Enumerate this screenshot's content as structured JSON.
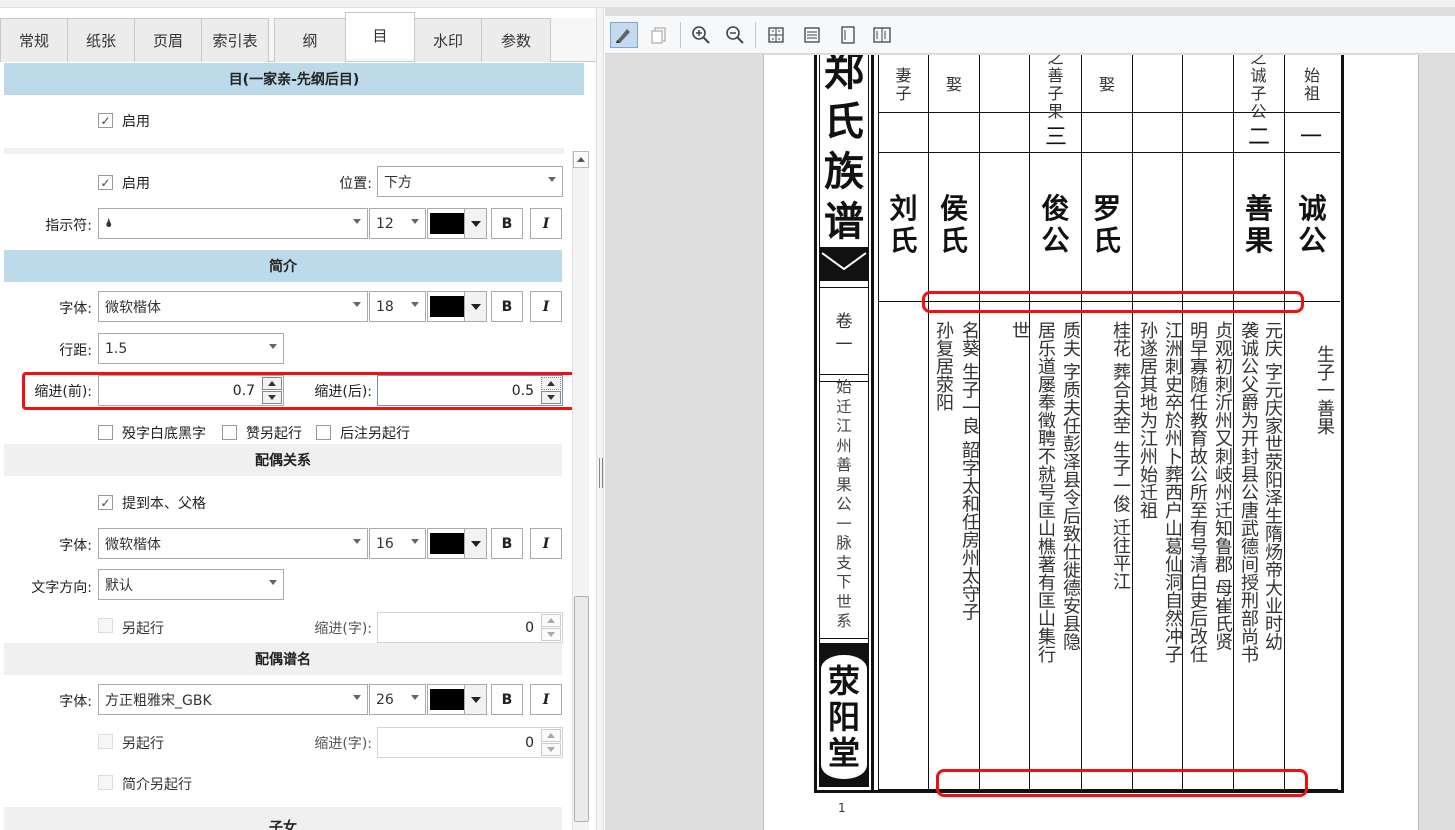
{
  "tabs": [
    "常规",
    "纸张",
    "页眉",
    "索引表",
    "纲",
    "目",
    "水印",
    "参数"
  ],
  "active_tab": "目",
  "sections": {
    "mu_title": "目(一家亲-先纲后目)",
    "jianjie": "简介",
    "peiou": "配偶关系",
    "peiou_pm": "配偶谱名",
    "zinv": "子女"
  },
  "labels": {
    "enable": "启用",
    "position": "位置:",
    "indicator": "指示符:",
    "font": "字体:",
    "line_spacing": "行距:",
    "indent_before": "缩进(前):",
    "indent_after": "缩进(后):",
    "cb_yin": "殁字白底黑字",
    "cb_zan": "赞另起行",
    "cb_houzhu": "后注另起行",
    "promote": "提到本、父格",
    "text_dir": "文字方向:",
    "new_line": "另起行",
    "indent_chars": "缩进(字):",
    "jianjie_new_line": "简介另起行",
    "bold": "B",
    "italic": "I"
  },
  "values": {
    "position": "下方",
    "indicator_glyph": "🌢",
    "indicator_size": "12",
    "jj_font": "微软楷体",
    "jj_size": "18",
    "line_spacing": "1.5",
    "indent_before": "0.7",
    "indent_after": "0.5",
    "po_font": "微软楷体",
    "po_size": "16",
    "text_dir": "默认",
    "po_indent": "0",
    "pm_font": "方正粗雅宋_GBK",
    "pm_size": "26",
    "pm_indent": "0"
  },
  "page": {
    "big_title": [
      "郑",
      "氏",
      "族",
      "谱"
    ],
    "vol": [
      "卷",
      "一"
    ],
    "sub": [
      "始",
      "迁",
      "江",
      "州",
      "善",
      "果",
      "公",
      "一",
      "脉",
      "支",
      "下",
      "世",
      "系"
    ],
    "hall": [
      "荥",
      "阳",
      "堂"
    ],
    "page_number": "1",
    "col_heads": [
      "始祖",
      "之诚子公",
      "",
      "",
      "",
      "娶",
      "之善子果",
      "",
      "娶",
      "妻子"
    ],
    "gen_numbers": [
      "一",
      "二",
      "三"
    ],
    "names": [
      {
        "n": "诚公"
      },
      {
        "n": "善果"
      },
      {
        "n": "罗氏"
      },
      {
        "n": "俊公"
      },
      {
        "n": "侯氏"
      },
      {
        "n": "刘氏"
      }
    ],
    "bio_cols": [
      "生子一善果",
      "元庆 字元庆家世荥阳泽生隋炀帝大业时幼",
      "袭诚公父爵为开封县公唐武德间授刑部尚书",
      "贞观初刺沂州又刺岐州迁知鲁郡 母崔氏贤",
      "明早寡随任教育故公所至有号清白吏后改任",
      "江洲刺史卒於州卜葬西户山葛仙洞自然冲子",
      "孙遂居其地为江州始迁祖",
      "桂花 葬合夫茔 生子一俊 迁往平江",
      "质夫 字质夫任彭泽县令后致仕徙德安县隐",
      "居乐道屡奉徵聘不就号匡山樵著有匡山集行",
      "世",
      "名葵 生子一良 韶字太和任房州太守子",
      "孙复居荥阳"
    ]
  }
}
